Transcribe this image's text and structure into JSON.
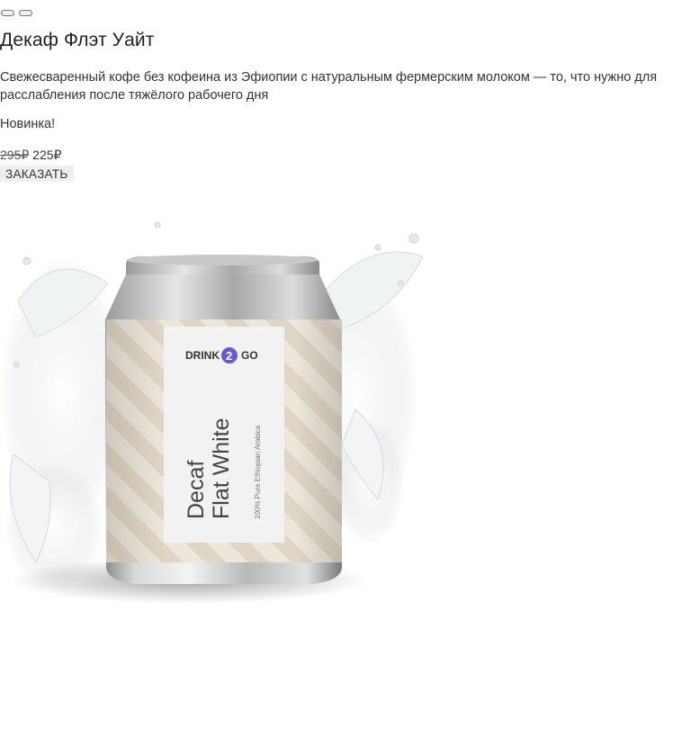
{
  "product": {
    "title": "Декаф Флэт Уайт",
    "description": "Свежесваренный кофе без кофеина из Эфиопии с натуральным фермерским молоком — то, что нужно для расслабления после тяжёлого рабочего дня",
    "badge": "Новинка!",
    "price_old": "295₽",
    "price_new": "225₽",
    "order_label": "ЗАКАЗАТЬ"
  },
  "can": {
    "brand_left": "DRINK",
    "brand_mid": "2",
    "brand_right": "GO",
    "name_line1": "Decaf",
    "name_line2": "Flat White",
    "subtitle": "100% Pure Ethiopian Arabica"
  },
  "colors": {
    "accent": "#6a5acd",
    "label_cream": "#ebe5da",
    "label_stripe": "#ddd3c2",
    "text_dark": "#333333"
  }
}
